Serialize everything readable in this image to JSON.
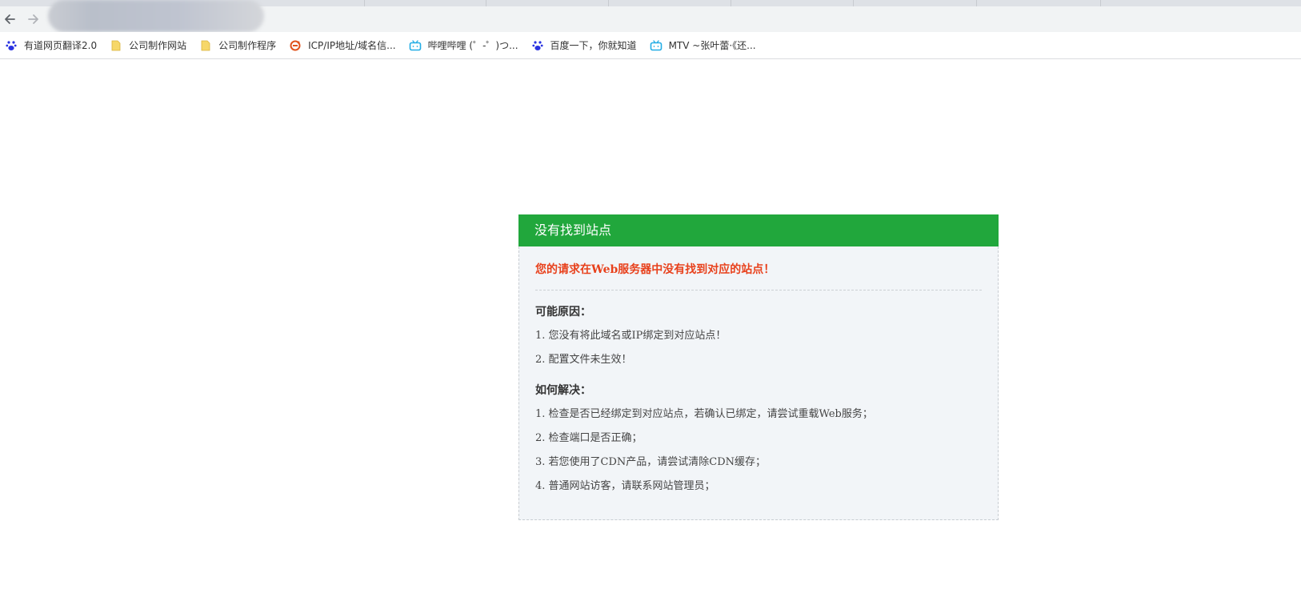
{
  "browser": {
    "address_value": "",
    "nav": {
      "back_icon": "arrow-left-icon",
      "forward_icon": "arrow-right-icon",
      "reload_icon": "reload-icon"
    },
    "bookmarks": [
      {
        "label": "有道网页翻译2.0",
        "icon": "baidu-paw-icon"
      },
      {
        "label": "公司制作网站",
        "icon": "folder-icon"
      },
      {
        "label": "公司制作程序",
        "icon": "folder-icon"
      },
      {
        "label": "ICP/IP地址/域名信...",
        "icon": "site-logo-icon"
      },
      {
        "label": "哔哩哔哩 (゜-゜)つ...",
        "icon": "bilibili-tv-icon"
      },
      {
        "label": "百度一下，你就知道",
        "icon": "baidu-paw-icon"
      },
      {
        "label": "MTV ~张叶蕾·《还...",
        "icon": "bilibili-tv-icon"
      }
    ]
  },
  "error": {
    "header_title": "没有找到站点",
    "headline": "您的请求在Web服务器中没有找到对应的站点！",
    "reasons_title": "可能原因：",
    "reasons": [
      "1. 您没有将此域名或IP绑定到对应站点！",
      "2. 配置文件未生效！"
    ],
    "solutions_title": "如何解决：",
    "solutions": [
      "1. 检查是否已经绑定到对应站点，若确认已绑定，请尝试重载Web服务；",
      "2. 检查端口是否正确；",
      "3. 若您使用了CDN产品，请尝试清除CDN缓存；",
      "4. 普通网站访客，请联系网站管理员；"
    ]
  },
  "colors": {
    "header_green": "#21a73c",
    "headline_red": "#e8411c",
    "card_bg": "#f2f5f8"
  }
}
